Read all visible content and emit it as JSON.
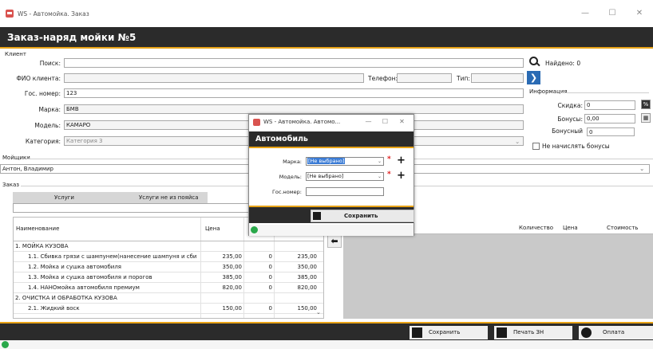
{
  "window": {
    "title": "WS - Автомойка. Заказ"
  },
  "header": {
    "title": "Заказ-наряд мойки №5"
  },
  "client": {
    "section_label": "Клиент",
    "search_label": "Поиск:",
    "search_value": "",
    "found_label": "Найдено: 0",
    "fio_label": "ФИО клиента:",
    "fio_value": "",
    "phone_label": "Телефон:",
    "type_label": "Тип:",
    "plate_label": "Гос. номер:",
    "plate_value": "123",
    "brand_label": "Марка:",
    "brand_value": "БМВ",
    "model_label": "Модель:",
    "model_value": "КАМАРО",
    "category_label": "Категория:",
    "category_value": "Категория 3"
  },
  "info": {
    "title": "Информация",
    "discount_label": "Скидка:",
    "discount_value": "0",
    "bonuses_label": "Бонусы:",
    "bonuses_value": "0,00",
    "bonus_label": "Бонусный",
    "bonus_value": "0",
    "no_bonus_label": "Не начислять бонусы",
    "percent_btn": "%"
  },
  "washers": {
    "section_label": "Мойщики",
    "value": "Антон, Владимир"
  },
  "order": {
    "section_label": "Заказ",
    "tabs": [
      {
        "label": "Услуги"
      },
      {
        "label": "Услуги не из пояйса"
      }
    ],
    "columns": {
      "name": "Наименование",
      "price": "Цена"
    },
    "rows": [
      {
        "name": "1. МОЙКА КУЗОВА",
        "price": "",
        "qty": "",
        "total": "",
        "group": true
      },
      {
        "name": "1.1. Сбивка грязи с шампунем(нанесение шампуня и сби",
        "price": "235,00",
        "qty": "0",
        "total": "235,00",
        "group": false
      },
      {
        "name": "1.2. Мойка и сушка автомобиля",
        "price": "350,00",
        "qty": "0",
        "total": "350,00",
        "group": false
      },
      {
        "name": "1.3. Мойка и сушка автомобиля и порогов",
        "price": "385,00",
        "qty": "0",
        "total": "385,00",
        "group": false
      },
      {
        "name": "1.4. НАНОмойка автомобиля премиум",
        "price": "820,00",
        "qty": "0",
        "total": "820,00",
        "group": false
      },
      {
        "name": "2. ОЧИСТКА И ОБРАБОТКА КУЗОВА",
        "price": "",
        "qty": "",
        "total": "",
        "group": true
      },
      {
        "name": "2.1. Жидкий воск",
        "price": "150,00",
        "qty": "0",
        "total": "150,00",
        "group": false
      }
    ],
    "right_columns": {
      "qty": "Количество",
      "price": "Цена",
      "total": "Стоимость"
    }
  },
  "footer": {
    "save": "Сохранить",
    "print": "Печать ЗН",
    "pay": "Оплата"
  },
  "modal": {
    "title": "WS - Автомойка. Автомо...",
    "header": "Автомобиль",
    "brand_label": "Марка:",
    "brand_value": "[Не выбрано]",
    "model_label": "Модель:",
    "model_value": "[Не выбрано]",
    "plate_label": "Гос.номер:",
    "plate_value": "",
    "save": "Сохранить"
  },
  "colors": {
    "accent": "#e8a317",
    "dark": "#2b2b2b",
    "link": "#2a6bb4",
    "ok": "#2aa84a"
  }
}
